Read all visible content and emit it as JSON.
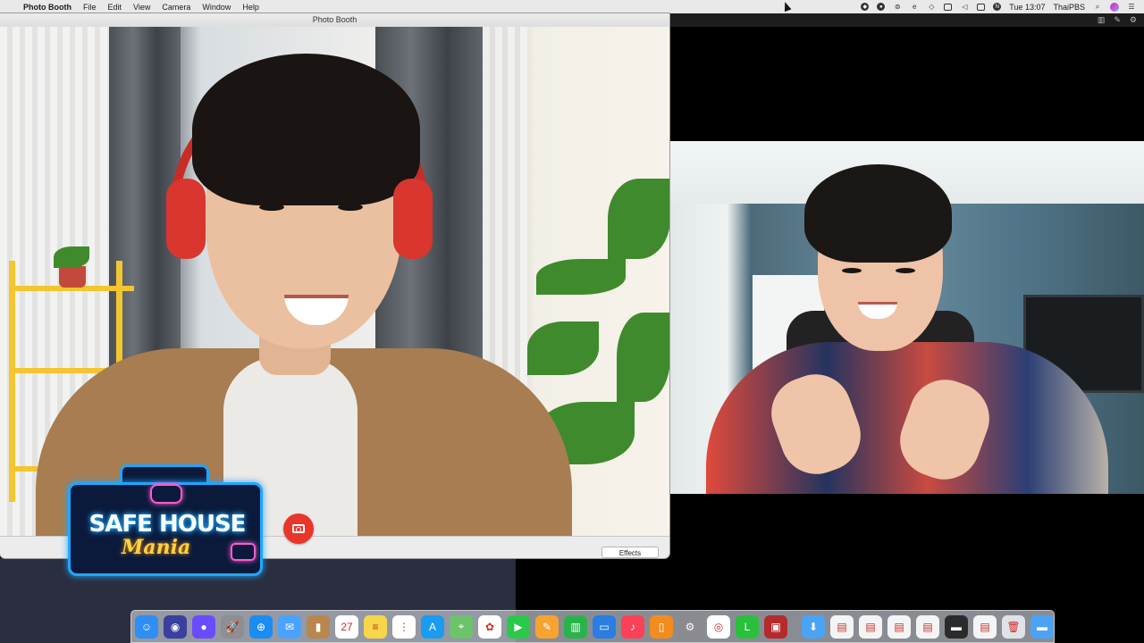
{
  "menubar": {
    "apple": "",
    "app_name": "Photo Booth",
    "menus": [
      "File",
      "Edit",
      "View",
      "Camera",
      "Window",
      "Help"
    ],
    "clock": "Tue 13:07",
    "user": "ThaiPBS",
    "status_icons": [
      "vpn-icon",
      "record-icon",
      "screen-icon",
      "edge-icon",
      "wifi-icon",
      "airplay-icon",
      "volume-icon",
      "battery-icon",
      "notes-icon",
      "clock-text",
      "user-text",
      "search-icon",
      "siri-icon",
      "notification-center-icon"
    ]
  },
  "photo_booth": {
    "window_title": "Photo Booth",
    "effects_label": "Effects",
    "shutter_icon": "camera-icon"
  },
  "overlay_logo": {
    "title": "SAFE HOUSE",
    "subtitle": "Mania"
  },
  "dock": {
    "apps": [
      {
        "name": "finder",
        "color": "#2f8ef4",
        "glyph": "☺"
      },
      {
        "name": "siri",
        "color": "#3b3f9e",
        "glyph": "◉"
      },
      {
        "name": "siri-orb",
        "color": "#6a4cff",
        "glyph": "●"
      },
      {
        "name": "launchpad",
        "color": "#8e8e93",
        "glyph": "🚀"
      },
      {
        "name": "safari",
        "color": "#1b8cf2",
        "glyph": "⊕"
      },
      {
        "name": "mail",
        "color": "#4aa3ff",
        "glyph": "✉"
      },
      {
        "name": "contacts",
        "color": "#b8874d",
        "glyph": "▮"
      },
      {
        "name": "calendar",
        "color": "#ffffff",
        "glyph": "27"
      },
      {
        "name": "notes",
        "color": "#f7d64a",
        "glyph": "≡"
      },
      {
        "name": "reminders",
        "color": "#ffffff",
        "glyph": "⋮"
      },
      {
        "name": "app-store",
        "color": "#1a9cf0",
        "glyph": "A"
      },
      {
        "name": "maps",
        "color": "#6cc46a",
        "glyph": "⌖"
      },
      {
        "name": "photos",
        "color": "#ffffff",
        "glyph": "✿"
      },
      {
        "name": "facetime",
        "color": "#2bc94a",
        "glyph": "▶"
      },
      {
        "name": "pages",
        "color": "#f6a331",
        "glyph": "✎"
      },
      {
        "name": "numbers",
        "color": "#2bb34b",
        "glyph": "▥"
      },
      {
        "name": "keynote",
        "color": "#2a7de1",
        "glyph": "▭"
      },
      {
        "name": "music",
        "color": "#fb4157",
        "glyph": "♪"
      },
      {
        "name": "books",
        "color": "#f28c1f",
        "glyph": "▯"
      },
      {
        "name": "system-preferences",
        "color": "#8a8a8f",
        "glyph": "⚙"
      },
      {
        "name": "chrome",
        "color": "#ffffff",
        "glyph": "◎"
      },
      {
        "name": "line",
        "color": "#2ac03c",
        "glyph": "L"
      },
      {
        "name": "photo-booth",
        "color": "#b52b2b",
        "glyph": "▣"
      }
    ],
    "docs": [
      {
        "name": "downloads-folder",
        "color": "#4aa3f5",
        "glyph": "⬇"
      },
      {
        "name": "document-1",
        "color": "#f4f4f4",
        "glyph": "▤"
      },
      {
        "name": "document-2",
        "color": "#f4f4f4",
        "glyph": "▤"
      },
      {
        "name": "document-3",
        "color": "#f4f4f4",
        "glyph": "▤"
      },
      {
        "name": "document-4",
        "color": "#f4f4f4",
        "glyph": "▤"
      },
      {
        "name": "screenshot",
        "color": "#2b2b2b",
        "glyph": "▬"
      },
      {
        "name": "document-5",
        "color": "#f4f4f4",
        "glyph": "▤"
      },
      {
        "name": "trash",
        "color": "#dfe3e8",
        "glyph": "🗑"
      },
      {
        "name": "folder",
        "color": "#4aa3f5",
        "glyph": "▬"
      }
    ]
  }
}
